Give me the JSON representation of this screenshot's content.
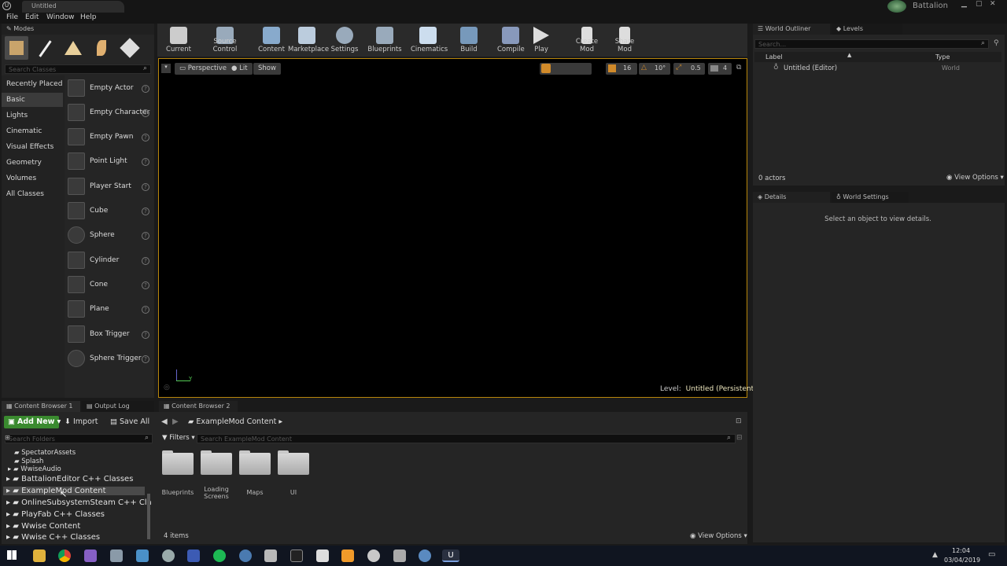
{
  "window": {
    "title": "Untitled",
    "project": "Battalion"
  },
  "menu": [
    "File",
    "Edit",
    "Window",
    "Help"
  ],
  "modes": {
    "tab": "Modes",
    "search_placeholder": "Search Classes",
    "categories": [
      "Recently Placed",
      "Basic",
      "Lights",
      "Cinematic",
      "Visual Effects",
      "Geometry",
      "Volumes",
      "All Classes"
    ],
    "items": [
      "Empty Actor",
      "Empty Character",
      "Empty Pawn",
      "Point Light",
      "Player Start",
      "Cube",
      "Sphere",
      "Cylinder",
      "Cone",
      "Plane",
      "Box Trigger",
      "Sphere Trigger"
    ]
  },
  "toolbar": [
    "Save Current",
    "Source Control",
    "Content",
    "Marketplace",
    "Settings",
    "Blueprints",
    "Cinematics",
    "Build",
    "Compile",
    "Play",
    "Create Mod",
    "Share Mod"
  ],
  "viewport": {
    "perspective": "Perspective",
    "lit": "Lit",
    "show": "Show",
    "grid": "16",
    "angle": "10°",
    "scale": "0.5",
    "cams": "4",
    "level_label": "Level:",
    "level_name": "Untitled (Persistent)"
  },
  "outliner": {
    "tab": "World Outliner",
    "tab2": "Levels",
    "search_placeholder": "Search...",
    "col_label": "Label",
    "col_type": "Type",
    "row_label": "Untitled (Editor)",
    "row_type": "World",
    "count": "0 actors",
    "view_options": "View Options"
  },
  "details": {
    "tab": "Details",
    "tab2": "World Settings",
    "empty": "Select an object to view details."
  },
  "bottom_tabs": [
    "Content Browser 1",
    "Output Log",
    "Content Browser 2"
  ],
  "content": {
    "add_new": "Add New",
    "import": "Import",
    "save_all": "Save All",
    "path": "ExampleMod Content",
    "filters": "Filters",
    "search_folders": "Search Folders",
    "search_content": "Search ExampleMod Content",
    "tree_small": [
      "SpectatorAssets",
      "Splash",
      "WwiseAudio"
    ],
    "tree": [
      "BattalionEditor C++ Classes",
      "ExampleMod Content",
      "OnlineSubsystemSteam C++ Classes",
      "PlayFab C++ Classes",
      "Wwise Content",
      "Wwise C++ Classes"
    ],
    "folders": [
      "Blueprints",
      "Loading Screens",
      "Maps",
      "UI"
    ],
    "count": "4 items",
    "view_options": "View Options"
  },
  "taskbar": {
    "time": "12:04",
    "date": "03/04/2019"
  }
}
